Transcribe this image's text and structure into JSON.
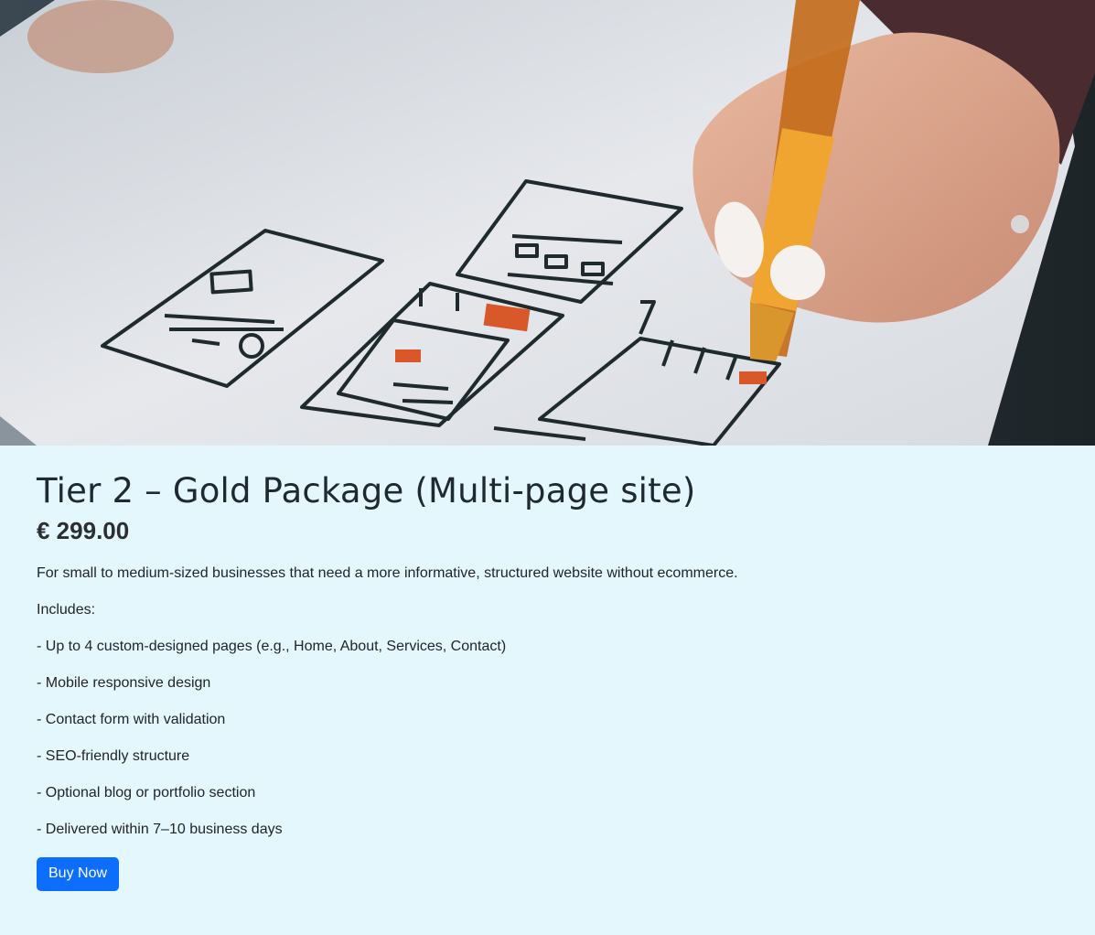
{
  "hero": {
    "icon": "wireframe-sketch-photo"
  },
  "product": {
    "title": "Tier 2 – Gold Package (Multi-page site)",
    "price": "€ 299.00",
    "description": "For small to medium-sized businesses that need a more informative, structured website without ecommerce.",
    "includes_label": "Includes:",
    "features": [
      "- Up to 4 custom-designed pages (e.g., Home, About, Services, Contact)",
      "- Mobile responsive design",
      "- Contact form with validation",
      "- SEO-friendly structure",
      "- Optional blog or portfolio section",
      "- Delivered within 7–10 business days"
    ],
    "buy_label": "Buy Now"
  },
  "colors": {
    "background": "#e4f7fd",
    "button": "#0d6efd"
  }
}
